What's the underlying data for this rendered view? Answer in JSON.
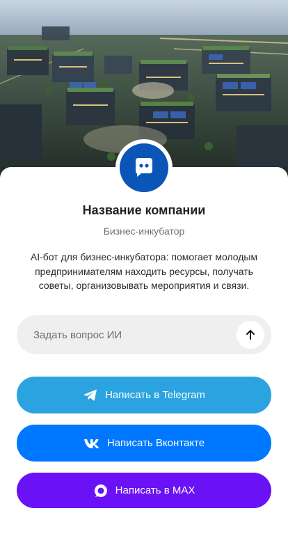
{
  "hero": {
    "image": "aerial-business-campus"
  },
  "company": {
    "avatar_icon": "chat-bot-icon",
    "name": "Название компании",
    "type": "Бизнес-инкубатор",
    "description": "AI-бот для бизнес-инкубатора: помогает молодым предпринимателям находить ресурсы, получать советы, организовывать мероприятия и связи."
  },
  "ask": {
    "placeholder": "Задать вопрос ИИ",
    "value": "",
    "send_icon": "arrow-up-icon"
  },
  "buttons": {
    "telegram": {
      "label": "Написать в Telegram",
      "icon": "telegram-icon",
      "color": "#2aa3e0"
    },
    "vk": {
      "label": "Написать Вконтакте",
      "icon": "vk-icon",
      "color": "#0077ff"
    },
    "max": {
      "label": "Написать в MAX",
      "icon": "max-icon",
      "color": "#6a12f5"
    }
  },
  "colors": {
    "avatar_bg": "#0b55b7",
    "input_bg": "#efefef"
  }
}
